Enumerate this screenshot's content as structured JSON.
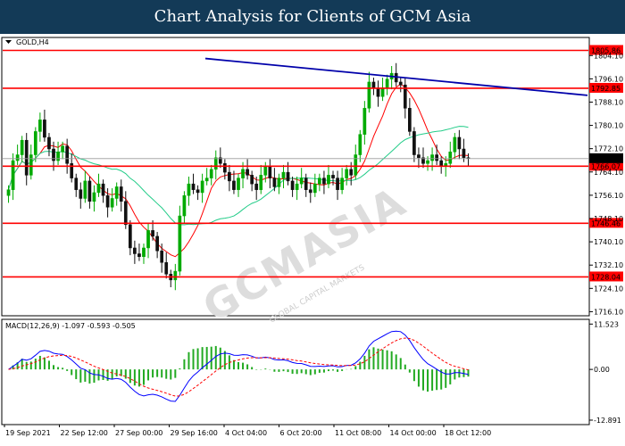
{
  "banner": {
    "title": "Chart Analysis for Clients of GCM Asia"
  },
  "chart_data": {
    "type": "candlestick",
    "symbol_label": "GOLD,H4",
    "y_ticks": [
      "1804.10",
      "1796.10",
      "1788.10",
      "1780.10",
      "1772.10",
      "1764.10",
      "1756.10",
      "1748.10",
      "1740.10",
      "1732.10",
      "1724.10",
      "1716.10"
    ],
    "ylim": [
      1715,
      1810
    ],
    "x_ticks": [
      "19 Sep 2021",
      "22 Sep 12:00",
      "27 Sep 00:00",
      "29 Sep 16:00",
      "4 Oct 04:00",
      "6 Oct 20:00",
      "11 Oct 08:00",
      "14 Oct 00:00",
      "18 Oct 12:00"
    ],
    "levels": [
      {
        "value": 1805.86,
        "label": "1805.86",
        "color": "#ff0000"
      },
      {
        "value": 1792.85,
        "label": "1792.85",
        "color": "#ff0000"
      },
      {
        "value": 1766.07,
        "label": "1766.07",
        "color": "#ff0000"
      },
      {
        "value": 1746.46,
        "label": "1746.46",
        "color": "#ff0000"
      },
      {
        "value": 1728.04,
        "label": "1728.04",
        "color": "#ff0000"
      }
    ],
    "current_price": {
      "value": 1768.68,
      "label": "1768.68"
    },
    "trendline": {
      "start": [
        -6,
        1810.5
      ],
      "end": [
        148,
        1787.5
      ],
      "color": "#0000aa"
    },
    "close_series": [
      1758,
      1768,
      1770,
      1775,
      1763,
      1770,
      1778,
      1782,
      1776,
      1772,
      1768,
      1771,
      1773,
      1767,
      1762,
      1758,
      1755,
      1761,
      1754,
      1757,
      1760,
      1756,
      1752,
      1755,
      1759,
      1754,
      1746,
      1738,
      1736,
      1735,
      1738,
      1744,
      1742,
      1737,
      1733,
      1729,
      1727,
      1730,
      1749,
      1756,
      1760,
      1758,
      1757,
      1761,
      1762,
      1765,
      1769,
      1767,
      1764,
      1761,
      1758,
      1762,
      1765,
      1763,
      1760,
      1758,
      1763,
      1766,
      1762,
      1759,
      1762,
      1764,
      1761,
      1758,
      1760,
      1762,
      1758,
      1757,
      1760,
      1762,
      1760,
      1763,
      1762,
      1758,
      1762,
      1765,
      1763,
      1770,
      1777,
      1786,
      1795,
      1793,
      1790,
      1793,
      1796,
      1798,
      1795,
      1794,
      1786,
      1778,
      1770,
      1769,
      1767,
      1768,
      1770,
      1768,
      1766,
      1767,
      1771,
      1776,
      1772,
      1769,
      1768.7
    ],
    "ma_fast": {
      "color": "#ff0000"
    },
    "ma_slow": {
      "color": "#22cc88"
    },
    "macd": {
      "label": "MACD(12,26,9) -1.097 -0.593 -0.505",
      "ylim": [
        -13.8,
        12.5
      ],
      "y_ticks": [
        "11.523",
        "0.00",
        "-12.891"
      ],
      "tick_values": [
        11.523,
        0,
        -12.891
      ],
      "line_color": "#0000ff",
      "signal_color": "#ff0000",
      "hist_color": "#22aa22"
    },
    "current_price_bg": "#000000",
    "bull_color": "#00aa00",
    "bear_color": "#111111"
  },
  "watermark": {
    "text": "GCMASIA",
    "sub": "GLOBAL CAPITAL MARKETS"
  }
}
